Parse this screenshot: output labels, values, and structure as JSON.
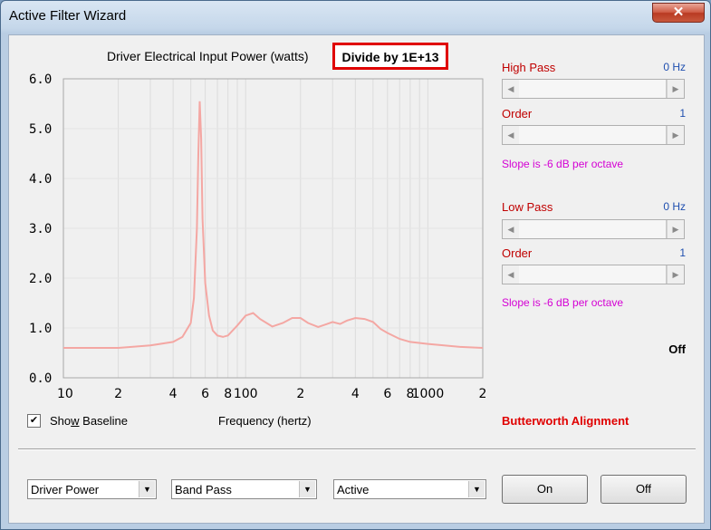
{
  "window": {
    "title": "Active Filter Wizard",
    "close_glyph": "✕"
  },
  "chart_header": {
    "title": "Driver Electrical Input Power (watts)",
    "scale_note": "Divide by 1E+13"
  },
  "chart_data": {
    "type": "line",
    "title": "Driver Electrical Input Power (watts)",
    "xlabel": "Frequency (hertz)",
    "ylabel": "",
    "x_scale": "log",
    "xlim": [
      10,
      2000
    ],
    "ylim": [
      0,
      6
    ],
    "grid": true,
    "y_ticks": [
      "0.0",
      "1.0",
      "2.0",
      "3.0",
      "4.0",
      "5.0",
      "6.0"
    ],
    "x_ticks": [
      "10",
      "2",
      "4",
      "6",
      "8",
      "100",
      "2",
      "4",
      "6",
      "8",
      "1000",
      "2"
    ],
    "line_color": "#f4a7a3",
    "series": [
      {
        "x": [
          10,
          20,
          30,
          40,
          45,
          50,
          52,
          54,
          55,
          56,
          57,
          58,
          60,
          63,
          66,
          70,
          75,
          80,
          90,
          100,
          110,
          120,
          140,
          160,
          180,
          200,
          220,
          250,
          280,
          300,
          330,
          360,
          400,
          450,
          500,
          550,
          600,
          700,
          800,
          1000,
          1500,
          2000
        ],
        "values": [
          0.6,
          0.6,
          0.65,
          0.72,
          0.82,
          1.1,
          1.6,
          3.0,
          4.5,
          5.55,
          4.8,
          3.2,
          1.9,
          1.25,
          0.95,
          0.85,
          0.82,
          0.85,
          1.05,
          1.25,
          1.3,
          1.18,
          1.03,
          1.1,
          1.2,
          1.2,
          1.1,
          1.02,
          1.08,
          1.12,
          1.08,
          1.15,
          1.2,
          1.18,
          1.12,
          0.98,
          0.9,
          0.78,
          0.72,
          0.68,
          0.62,
          0.6
        ]
      }
    ]
  },
  "controls": {
    "show_baseline": {
      "checked": true,
      "check_glyph": "✔",
      "label_before": "Sho",
      "label_mnemonic": "w",
      "label_after": " Baseline"
    },
    "frequency_label": "Frequency (hertz)",
    "high_pass": {
      "label": "High Pass",
      "value": "0 Hz",
      "order_label": "Order",
      "order_value": "1",
      "slope": "Slope is -6 dB per octave"
    },
    "low_pass": {
      "label": "Low Pass",
      "value": "0 Hz",
      "order_label": "Order",
      "order_value": "1",
      "slope": "Slope is -6 dB per octave"
    },
    "status": "Off",
    "alignment": "Butterworth Alignment",
    "arrows": {
      "left": "◀",
      "right": "▶",
      "down": "▼"
    },
    "combo_plot": "Driver Power",
    "combo_filter": "Band Pass",
    "combo_mode": "Active",
    "on_button": "On",
    "off_button": "Off"
  },
  "colors": {
    "accent_red": "#c00000",
    "value_blue": "#1f4faf",
    "slope_magenta": "#d400d4",
    "highlight_box": "#e00000"
  }
}
